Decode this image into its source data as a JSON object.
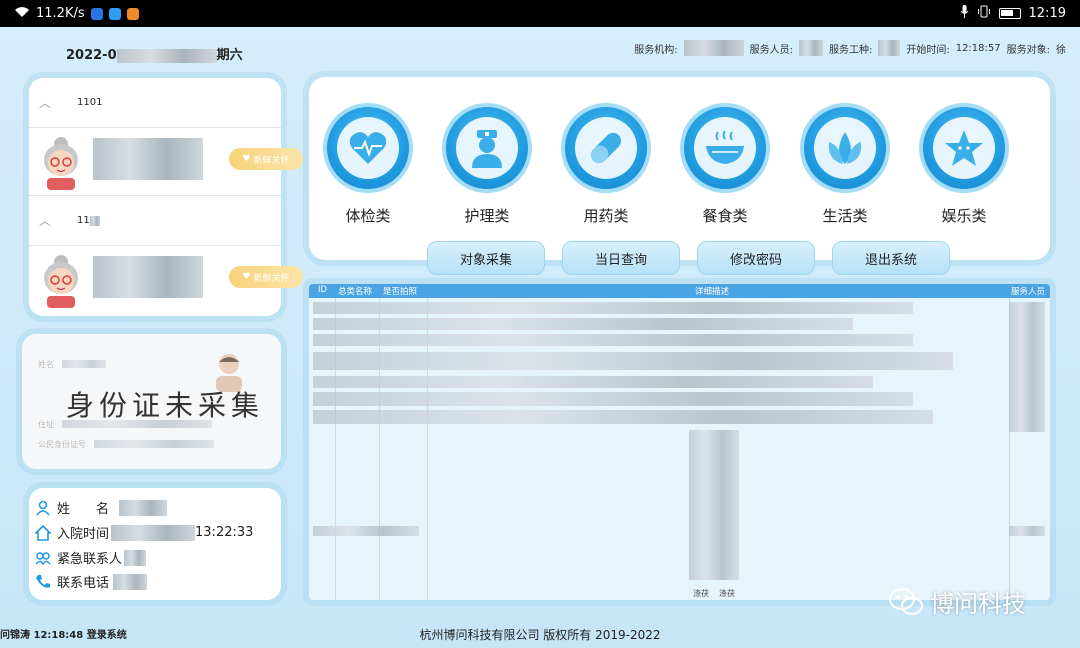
{
  "status_bar": {
    "net_speed": "11.2K/s",
    "time": "12:19"
  },
  "header": {
    "date_prefix": "2022-0",
    "date_suffix": "期六",
    "service_org_label": "服务机构:",
    "service_person_label": "服务人员:",
    "service_type_label": "服务工种:",
    "start_time_label": "开始时间:",
    "start_time": "12:18:57",
    "service_target_label": "服务对象:",
    "service_target": "徐"
  },
  "residents": [
    {
      "room": "1101",
      "tag": "新鲜关怀"
    },
    {
      "room": "11",
      "tag": "新鲜关怀"
    }
  ],
  "idcard": {
    "name_label": "姓名",
    "address_label": "住址",
    "id_label": "公民身份证号",
    "title": "身份证未采集"
  },
  "person": {
    "name_label": "姓　　名",
    "admit_label": "入院时间",
    "admit_time": "13:22:33",
    "emergency_label": "紧急联系人",
    "phone_label": "联系电话"
  },
  "categories": [
    {
      "label": "体检类",
      "icon": "heart-pulse-icon"
    },
    {
      "label": "护理类",
      "icon": "nurse-icon"
    },
    {
      "label": "用药类",
      "icon": "pill-icon"
    },
    {
      "label": "餐食类",
      "icon": "food-bowl-icon"
    },
    {
      "label": "生活类",
      "icon": "leaf-icon"
    },
    {
      "label": "娱乐类",
      "icon": "star-icon"
    }
  ],
  "actions": [
    "对象采集",
    "当日查询",
    "修改密码",
    "退出系统"
  ],
  "table": {
    "headers": [
      "ID",
      "总类名称",
      "是否拍照",
      "详细描述",
      "服务人员"
    ],
    "footer_cells": [
      "涤茯",
      "涤茯"
    ]
  },
  "footer": {
    "left_text": "问锦涛 12:18:48 登录系统",
    "copyright": "杭州博问科技有限公司  版权所有 2019-2022"
  },
  "watermark": "博问科技",
  "colors": {
    "accent": "#1f9be0",
    "table_header": "#4aa3e3",
    "tag": "#f7d37a"
  }
}
